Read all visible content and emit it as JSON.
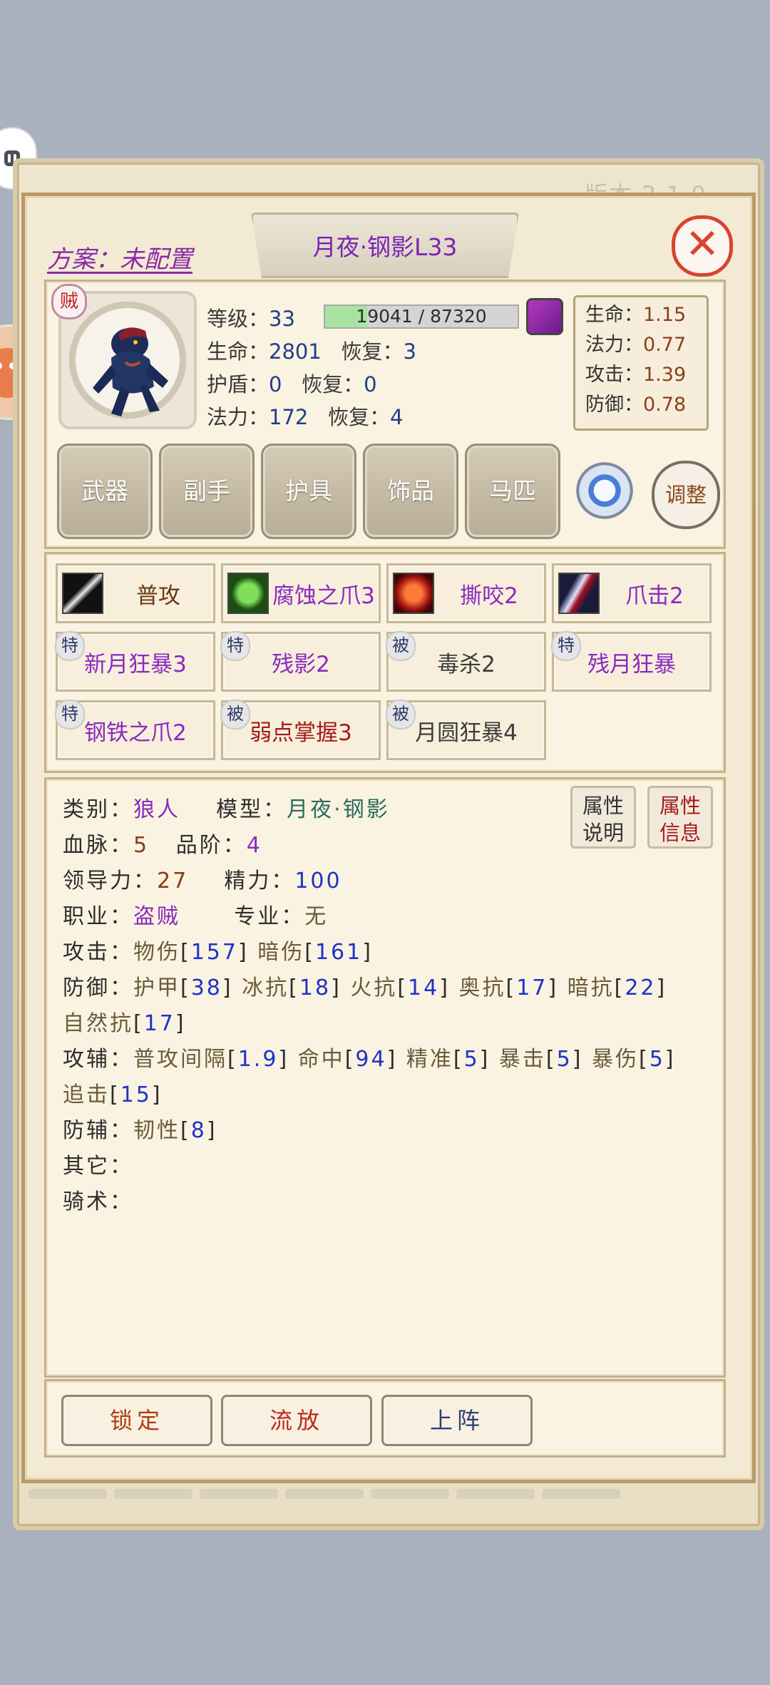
{
  "version_text": "版本 2.1.0",
  "plan_label": "方案：未配置",
  "title": "月夜·钢影L33",
  "close_icon": "close-icon",
  "hero": {
    "class_badge": "贼",
    "level_label": "等级：",
    "level": "33",
    "exp_text": "19041 / 87320",
    "exp_current": 19041,
    "exp_max": 87320,
    "hp_label": "生命：",
    "hp": "2801",
    "hp_regen_label": "恢复：",
    "hp_regen": "3",
    "shield_label": "护盾：",
    "shield": "0",
    "shield_regen_label": "恢复：",
    "shield_regen": "0",
    "mp_label": "法力：",
    "mp": "172",
    "mp_regen_label": "恢复：",
    "mp_regen": "4"
  },
  "ratios": [
    {
      "label": "生命：",
      "value": "1.15"
    },
    {
      "label": "法力：",
      "value": "0.77"
    },
    {
      "label": "攻击：",
      "value": "1.39"
    },
    {
      "label": "防御：",
      "value": "0.78"
    }
  ],
  "equipment": [
    "武器",
    "副手",
    "护具",
    "饰品",
    "马匹"
  ],
  "adjust_label": "调整",
  "skills": [
    {
      "label": "普攻",
      "icon": "sword-icon"
    },
    {
      "label": "腐蚀之爪3",
      "icon": "green-fist-icon"
    },
    {
      "label": "撕咬2",
      "icon": "fang-mouth-icon"
    },
    {
      "label": "爪击2",
      "icon": "claw-slash-icon"
    },
    {
      "label": "新月狂暴3",
      "tag": "特"
    },
    {
      "label": "残影2",
      "tag": "特"
    },
    {
      "label": "毒杀2",
      "tag": "被"
    },
    {
      "label": "残月狂暴",
      "tag": "特"
    },
    {
      "label": "钢铁之爪2",
      "tag": "特"
    },
    {
      "label": "弱点掌握3",
      "tag": "被"
    },
    {
      "label": "月圆狂暴4",
      "tag": "被"
    }
  ],
  "info": {
    "category_label": "类别：",
    "category": "狼人",
    "model_label": "模型：",
    "model": "月夜·钢影",
    "bloodline_label": "血脉：",
    "bloodline": "5",
    "grade_label": "品阶：",
    "grade": "4",
    "leadership_label": "领导力：",
    "leadership": "27",
    "energy_label": "精力：",
    "energy": "100",
    "job_label": "职业：",
    "job": "盗贼",
    "specialty_label": "专业：",
    "specialty": "无",
    "attack_label": "攻击：",
    "attack": {
      "phys_label": "物伤",
      "phys": "157",
      "dark_label": "暗伤",
      "dark": "161"
    },
    "defense_label": "防御：",
    "defense": {
      "armor_label": "护甲",
      "armor": "38",
      "ice_label": "冰抗",
      "ice": "18",
      "fire_label": "火抗",
      "fire": "14",
      "arcane_label": "奥抗",
      "arcane": "17",
      "dark_label": "暗抗",
      "dark": "22",
      "nature_label": "自然抗",
      "nature": "17"
    },
    "offense_aux_label": "攻辅：",
    "offense_aux": {
      "interval_label": "普攻间隔",
      "interval": "1.9",
      "hit_label": "命中",
      "hit": "94",
      "precision_label": "精准",
      "precision": "5",
      "crit_label": "暴击",
      "crit": "5",
      "critdmg_label": "暴伤",
      "critdmg": "5",
      "pursuit_label": "追击",
      "pursuit": "15"
    },
    "defense_aux_label": "防辅：",
    "defense_aux": {
      "tough_label": "韧性",
      "tough": "8"
    },
    "other_label": "其它：",
    "riding_label": "骑术："
  },
  "info_buttons": {
    "explain_l1": "属性",
    "explain_l2": "说明",
    "detail_l1": "属性",
    "detail_l2": "信息"
  },
  "actions": {
    "lock": "锁定",
    "exile": "流放",
    "deploy": "上阵"
  }
}
